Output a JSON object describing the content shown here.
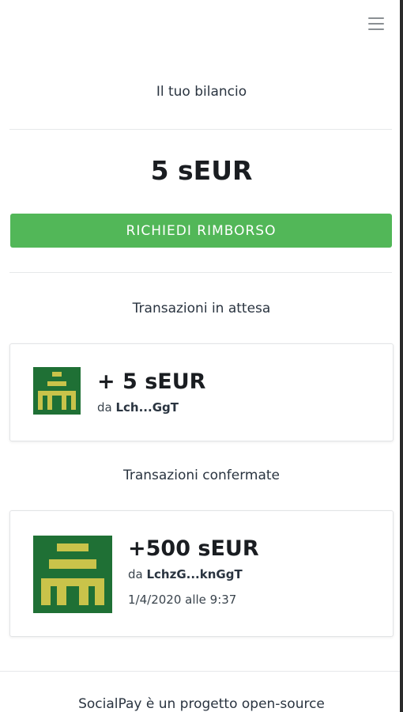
{
  "header": {
    "menu_icon": "hamburger-menu-icon"
  },
  "balance": {
    "label": "Il tuo bilancio",
    "amount": "5 sEUR",
    "refund_label": "RICHIEDI RIMBORSO"
  },
  "pending": {
    "title": "Transazioni in attesa",
    "items": [
      {
        "amount": "+ 5 sEUR",
        "from_prefix": "da ",
        "from": "Lch...GgT"
      }
    ]
  },
  "confirmed": {
    "title": "Transazioni confermate",
    "items": [
      {
        "amount": "+500 sEUR",
        "from_prefix": "da ",
        "from": "LchzG...knGgT",
        "timestamp": "1/4/2020 alle 9:37"
      }
    ]
  },
  "footer": {
    "text": "SocialPay è un progetto open-source"
  },
  "colors": {
    "accent": "#52b758",
    "avatar_bg": "#1f7035",
    "avatar_fg": "#c9c34a"
  }
}
